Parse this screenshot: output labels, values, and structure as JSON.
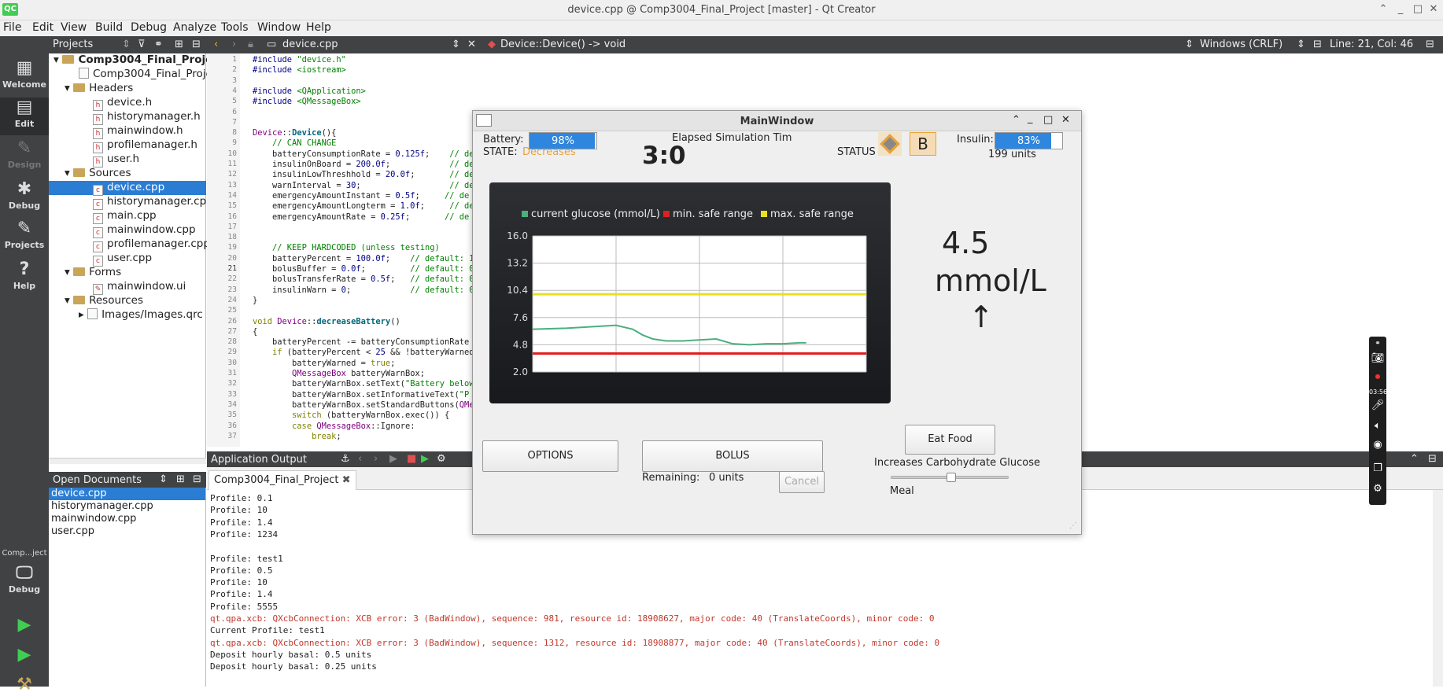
{
  "window_title": "device.cpp @ Comp3004_Final_Project [master] - Qt Creator",
  "menu": [
    "File",
    "Edit",
    "View",
    "Build",
    "Debug",
    "Analyze",
    "Tools",
    "Window",
    "Help"
  ],
  "toolbar": {
    "projects_label": "Projects",
    "file_tab": "device.cpp",
    "symbol": "Device::Device() -> void",
    "line_endings": "Windows (CRLF)",
    "cursor": "Line: 21, Col: 46"
  },
  "modes": [
    "Welcome",
    "Edit",
    "Design",
    "Debug",
    "Projects",
    "Help"
  ],
  "kit": {
    "project": "Comp...ject",
    "label": "Debug"
  },
  "project_tree": [
    {
      "label": "Comp3004_Final_Project",
      "kind": "root"
    },
    {
      "label": "Comp3004_Final_Project.pro",
      "kind": "file"
    },
    {
      "label": "Headers",
      "kind": "folder"
    },
    {
      "label": "device.h",
      "kind": "h"
    },
    {
      "label": "historymanager.h",
      "kind": "h"
    },
    {
      "label": "mainwindow.h",
      "kind": "h"
    },
    {
      "label": "profilemanager.h",
      "kind": "h"
    },
    {
      "label": "user.h",
      "kind": "h"
    },
    {
      "label": "Sources",
      "kind": "folder"
    },
    {
      "label": "device.cpp",
      "kind": "cpp",
      "selected": true
    },
    {
      "label": "historymanager.cpp",
      "kind": "cpp"
    },
    {
      "label": "main.cpp",
      "kind": "cpp"
    },
    {
      "label": "mainwindow.cpp",
      "kind": "cpp"
    },
    {
      "label": "profilemanager.cpp",
      "kind": "cpp"
    },
    {
      "label": "user.cpp",
      "kind": "cpp"
    },
    {
      "label": "Forms",
      "kind": "folder"
    },
    {
      "label": "mainwindow.ui",
      "kind": "ui"
    },
    {
      "label": "Resources",
      "kind": "folder"
    },
    {
      "label": "Images/Images.qrc",
      "kind": "qrc"
    }
  ],
  "open_documents": {
    "title": "Open Documents",
    "files": [
      "device.cpp",
      "historymanager.cpp",
      "mainwindow.cpp",
      "user.cpp"
    ]
  },
  "code_lines": [
    "<span class=\"pp\">#include</span> <span class=\"str\">\"device.h\"</span>",
    "<span class=\"pp\">#include</span> <span class=\"str\">&lt;iostream&gt;</span>",
    "",
    "<span class=\"pp\">#include</span> <span class=\"str\">&lt;QApplication&gt;</span>",
    "<span class=\"pp\">#include</span> <span class=\"str\">&lt;QMessageBox&gt;</span>",
    "",
    "",
    "<span class=\"cls\">Device</span>::<span class=\"fn\">Device</span>(){",
    "    <span class=\"cm\">// CAN CHANGE</span>",
    "    batteryConsumptionRate = <span class=\"num\">0.125f</span>;    <span class=\"cm\">// de</span>",
    "    insulinOnBoard = <span class=\"num\">200.0f</span>;            <span class=\"cm\">// de</span>",
    "    insulinLowThreshhold = <span class=\"num\">20.0f</span>;       <span class=\"cm\">// de</span>",
    "    warnInterval = <span class=\"num\">30</span>;                  <span class=\"cm\">// de</span>",
    "    emergencyAmountInstant = <span class=\"num\">0.5f</span>;     <span class=\"cm\">// de</span>",
    "    emergencyAmountLongterm = <span class=\"num\">1.0f</span>;     <span class=\"cm\">// de</span>",
    "    emergencyAmountRate = <span class=\"num\">0.25f</span>;       <span class=\"cm\">// de</span>",
    "",
    "",
    "    <span class=\"cm\">// KEEP HARDCODED (unless testing)</span>",
    "    batteryPercent = <span class=\"num\">100.0f</span>;    <span class=\"cm\">// default: 1</span>",
    "    bolusBuffer = <span class=\"num\">0.0f</span>;         <span class=\"cm\">// default: 0</span>",
    "    bolusTransferRate = <span class=\"num\">0.5f</span>;   <span class=\"cm\">// default: 0</span>",
    "    insulinWarn = <span class=\"num\">0</span>;            <span class=\"cm\">// default: 0</span>",
    "}",
    "",
    "<span class=\"kw\">void</span> <span class=\"cls\">Device</span>::<span class=\"fn\">decreaseBattery</span>()",
    "{",
    "    batteryPercent -= batteryConsumptionRate",
    "    <span class=\"kw\">if</span> (batteryPercent &lt; <span class=\"num\">25</span> &amp;&amp; !batteryWarned",
    "        batteryWarned = <span class=\"kw\">true</span>;",
    "        <span class=\"cls\">QMessageBox</span> batteryWarnBox;",
    "        batteryWarnBox.setText(<span class=\"str\">\"Battery below</span>",
    "        batteryWarnBox.setInformativeText(<span class=\"str\">\"P</span>",
    "        batteryWarnBox.setStandardButtons(<span class=\"cls\">QMe</span>",
    "        <span class=\"kw\">switch</span> (batteryWarnBox.exec()) {",
    "        <span class=\"kw\">case</span> <span class=\"cls\">QMessageBox</span>::Ignore:",
    "            <span class=\"kw\">break</span>;"
  ],
  "output": {
    "header": "Application Output",
    "tab": "Comp3004_Final_Project",
    "lines": [
      {
        "t": "Profile: 0.1"
      },
      {
        "t": "Profile: 10"
      },
      {
        "t": "Profile: 1.4"
      },
      {
        "t": "Profile: 1234"
      },
      {
        "t": ""
      },
      {
        "t": "Profile: test1"
      },
      {
        "t": "Profile: 0.5"
      },
      {
        "t": "Profile: 10"
      },
      {
        "t": "Profile: 1.4"
      },
      {
        "t": "Profile: 5555"
      },
      {
        "t": "qt.qpa.xcb: QXcbConnection: XCB error: 3 (BadWindow), sequence: 981, resource id: 18908627, major code: 40 (TranslateCoords), minor code: 0",
        "err": true
      },
      {
        "t": "Current Profile: test1"
      },
      {
        "t": "qt.qpa.xcb: QXcbConnection: XCB error: 3 (BadWindow), sequence: 1312, resource id: 18908877, major code: 40 (TranslateCoords), minor code: 0",
        "err": true
      },
      {
        "t": "Deposit hourly basal: 0.5 units"
      },
      {
        "t": "Deposit hourly basal: 0.25 units"
      }
    ]
  },
  "app": {
    "title": "MainWindow",
    "battery_label": "Battery:",
    "battery_percent": 98,
    "battery_text": "98%",
    "state_label": "STATE:",
    "state_value": "Decreases",
    "elapsed_label": "Elapsed Simulation Tim",
    "elapsed_value": "3:0",
    "status_label": "STATUS",
    "status_badge": "B",
    "insulin_label": "Insulin:",
    "insulin_percent": 83,
    "insulin_text": "83%",
    "insulin_units": "199 units",
    "glucose_value": "4.5",
    "glucose_unit": "mmol/L",
    "trend_arrow": "↑",
    "options_btn": "OPTIONS",
    "bolus_btn": "BOLUS",
    "remaining_label": "Remaining:",
    "remaining_value": "0 units",
    "cancel_btn": "Cancel",
    "eat_btn": "Eat Food",
    "carb_label": "Increases Carbohydrate Glucose le",
    "meal_label": "Meal",
    "meal_slider": 0.5
  },
  "recorder": {
    "time": "03:56"
  },
  "colors": {
    "current": "#4caf7d",
    "min": "#e02020",
    "max": "#e8e020",
    "accent": "#2e86de",
    "state": "#e8a33a"
  },
  "chart_data": {
    "type": "line",
    "legend": [
      "current glucose (mmol/L)",
      "min. safe range",
      "max. safe range"
    ],
    "yticks": [
      "16.0",
      "13.2",
      "10.4",
      "7.6",
      "4.8",
      "2.0"
    ],
    "ylim": [
      2.0,
      16.0
    ],
    "xlim": [
      0,
      100
    ],
    "series": [
      {
        "name": "current glucose (mmol/L)",
        "x": [
          0,
          10,
          20,
          25,
          30,
          33,
          36,
          40,
          45,
          50,
          55,
          60,
          65,
          70,
          75,
          80,
          82
        ],
        "y": [
          6.4,
          6.5,
          6.7,
          6.8,
          6.4,
          5.8,
          5.4,
          5.2,
          5.2,
          5.3,
          5.4,
          4.9,
          4.8,
          4.9,
          4.9,
          5.0,
          5.0
        ]
      },
      {
        "name": "min. safe range",
        "x": [
          0,
          100
        ],
        "y": [
          3.9,
          3.9
        ]
      },
      {
        "name": "max. safe range",
        "x": [
          0,
          100
        ],
        "y": [
          10.0,
          10.0
        ]
      }
    ]
  }
}
